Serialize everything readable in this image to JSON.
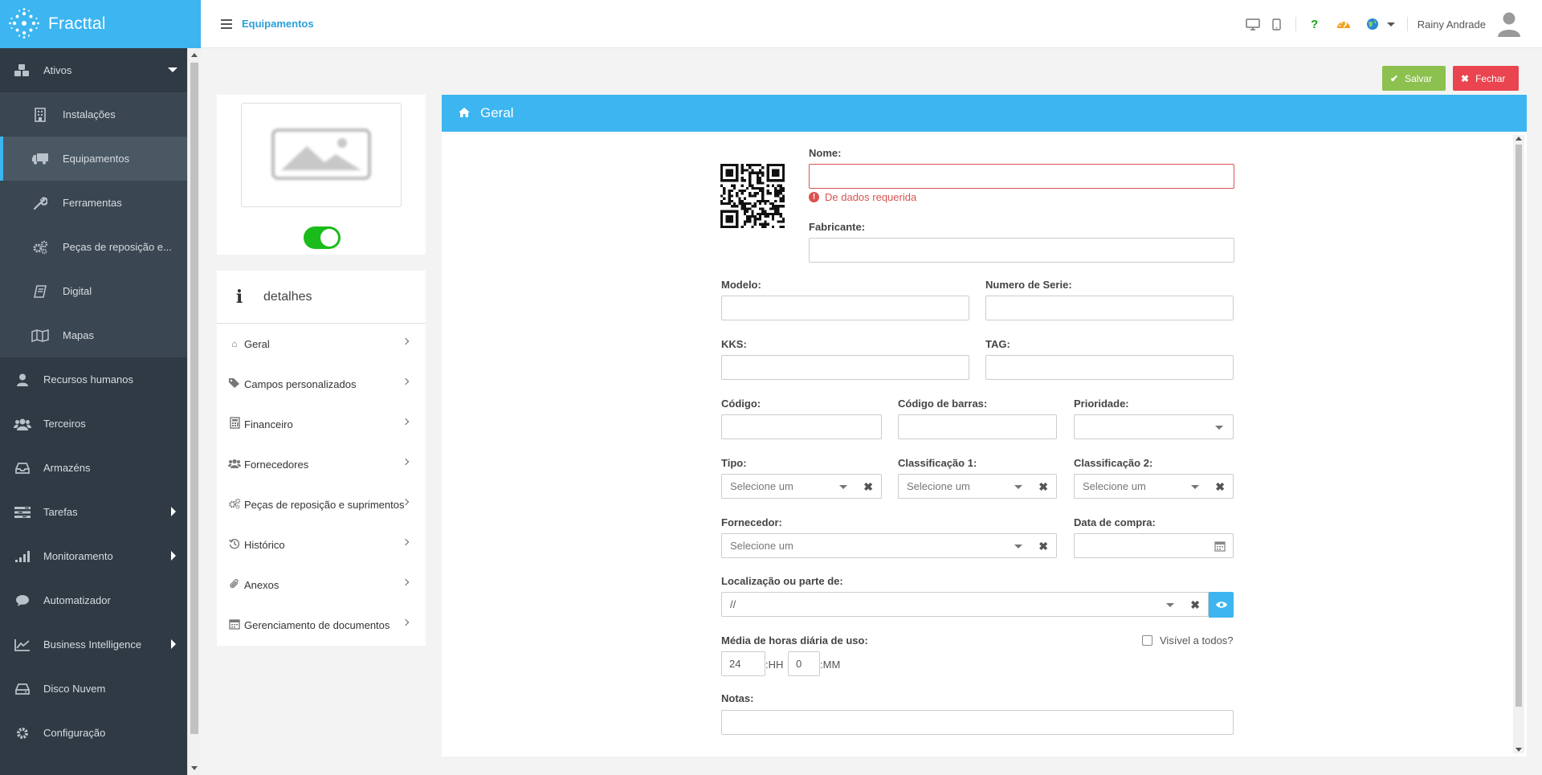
{
  "brand": {
    "name": "Fracttal"
  },
  "header": {
    "title": "Equipamentos",
    "user_name": "Rainy Andrade"
  },
  "sidebar": {
    "items": [
      {
        "label": "Ativos",
        "icon": "cubes-icon"
      },
      {
        "label": "Instalações",
        "icon": "building-icon"
      },
      {
        "label": "Equipamentos",
        "icon": "truck-icon"
      },
      {
        "label": "Ferramentas",
        "icon": "wrench-icon"
      },
      {
        "label": "Peças de reposição e...",
        "icon": "gears-icon"
      },
      {
        "label": "Digital",
        "icon": "book-icon"
      },
      {
        "label": "Mapas",
        "icon": "map-icon"
      },
      {
        "label": "Recursos humanos",
        "icon": "user-icon"
      },
      {
        "label": "Terceiros",
        "icon": "users-icon"
      },
      {
        "label": "Armazéns",
        "icon": "inbox-icon"
      },
      {
        "label": "Tarefas",
        "icon": "tasks-icon"
      },
      {
        "label": "Monitoramento",
        "icon": "signal-icon"
      },
      {
        "label": "Automatizador",
        "icon": "comment-icon"
      },
      {
        "label": "Business Intelligence",
        "icon": "line-chart-icon"
      },
      {
        "label": "Disco Nuvem",
        "icon": "hdd-icon"
      },
      {
        "label": "Configuração",
        "icon": "gear-icon"
      }
    ]
  },
  "actions": {
    "save": "Salvar",
    "close": "Fechar"
  },
  "details": {
    "title": "detalhes",
    "items": [
      {
        "label": "Geral",
        "icon": "home-icon"
      },
      {
        "label": "Campos personalizados",
        "icon": "tags-icon"
      },
      {
        "label": "Financeiro",
        "icon": "calculator-icon"
      },
      {
        "label": "Fornecedores",
        "icon": "users-icon"
      },
      {
        "label": "Peças de reposição e suprimentos",
        "icon": "gears-icon"
      },
      {
        "label": "Histórico",
        "icon": "history-icon"
      },
      {
        "label": "Anexos",
        "icon": "paperclip-icon"
      },
      {
        "label": "Gerenciamento de documentos",
        "icon": "calendar-icon"
      }
    ]
  },
  "form": {
    "section_title": "Geral",
    "nome": {
      "label": "Nome:",
      "value": "",
      "error": "De dados requerida"
    },
    "fabricante": {
      "label": "Fabricante:",
      "value": ""
    },
    "modelo": {
      "label": "Modelo:",
      "value": ""
    },
    "numero_serie": {
      "label": "Numero de Serie:",
      "value": ""
    },
    "kks": {
      "label": "KKS:",
      "value": ""
    },
    "tag": {
      "label": "TAG:",
      "value": ""
    },
    "codigo": {
      "label": "Código:",
      "value": ""
    },
    "codigo_barras": {
      "label": "Código de barras:",
      "value": ""
    },
    "prioridade": {
      "label": "Prioridade:",
      "value": ""
    },
    "tipo": {
      "label": "Tipo:",
      "value": "Selecione um"
    },
    "classificacao1": {
      "label": "Classificação 1:",
      "value": "Selecione um"
    },
    "classificacao2": {
      "label": "Classificação 2:",
      "value": "Selecione um"
    },
    "fornecedor": {
      "label": "Fornecedor:",
      "value": "Selecione um"
    },
    "data_compra": {
      "label": "Data de compra:",
      "value": ""
    },
    "localizacao": {
      "label": "Localização ou parte de:",
      "value": "//"
    },
    "media_horas": {
      "label": "Média de horas diária de uso:",
      "hours": "24",
      "hours_unit": ":HH",
      "minutes": "0",
      "minutes_unit": ":MM"
    },
    "visivel": {
      "label": "Visível a todos?",
      "checked": false
    },
    "notas": {
      "label": "Notas:",
      "value": ""
    }
  },
  "colors": {
    "accent": "#3cb5f0",
    "sidebar": "#2f3a44",
    "save": "#8dc14f",
    "close": "#e9444f",
    "error": "#d9534f",
    "toggle": "#1abc1a"
  }
}
